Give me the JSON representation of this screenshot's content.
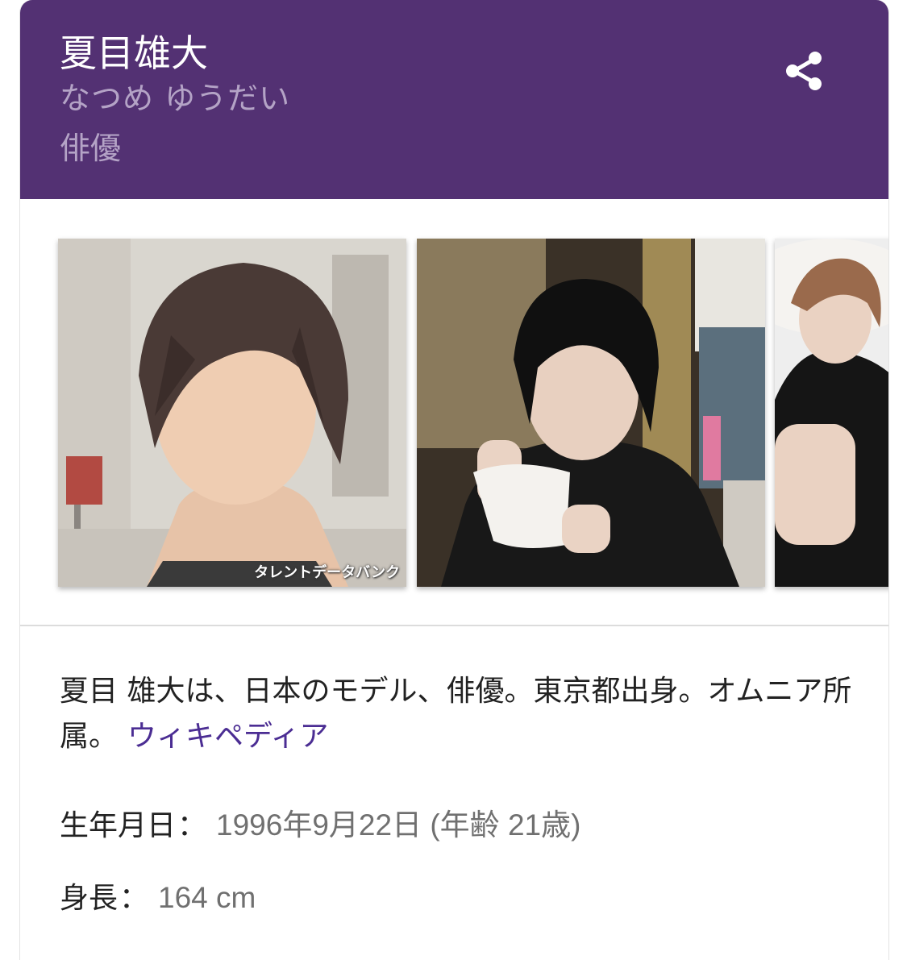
{
  "header": {
    "title": "夏目雄大",
    "reading": "なつめ ゆうだい",
    "subtitle": "俳優",
    "background": "#533173"
  },
  "share": {
    "icon": "share-icon"
  },
  "images": [
    {
      "caption": "タレントデータバンク"
    },
    {
      "caption": ""
    },
    {
      "caption": ""
    }
  ],
  "description": {
    "text": "夏目 雄大は、日本のモデル、俳優。東京都出身。オムニア所属。",
    "source_link": "ウィキペディア",
    "link_color": "#4b2d93"
  },
  "facts": [
    {
      "label": "生年月日",
      "separator": "：",
      "value": "1996年9月22日 (年齢 21歳)"
    },
    {
      "label": "身長",
      "separator": "：",
      "value": "164 cm"
    }
  ]
}
